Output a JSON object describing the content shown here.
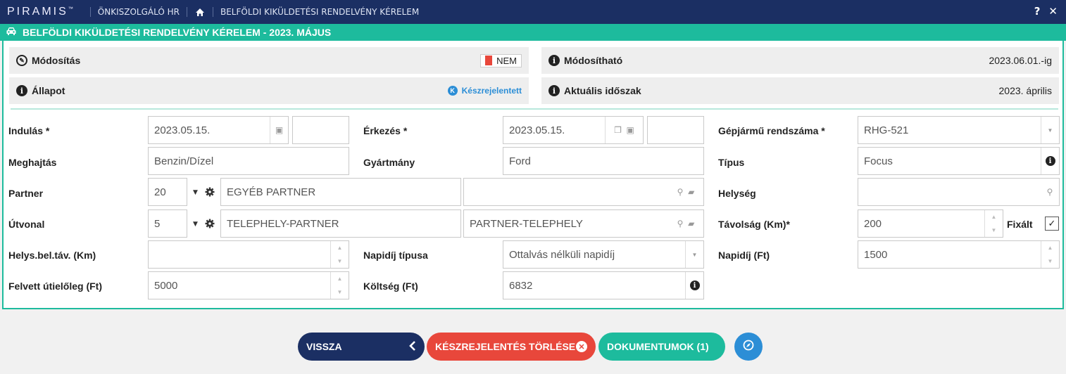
{
  "app": {
    "logo": "PIRAMIS",
    "tm": "™",
    "module": "ÖNKISZOLGÁLÓ HR",
    "page": "BELFÖLDI KIKÜLDETÉSI RENDELVÉNY KÉRELEM",
    "help": "?",
    "close": "✕"
  },
  "title": "BELFÖLDI KIKÜLDETÉSI RENDELVÉNY KÉRELEM - 2023. MÁJUS",
  "info": {
    "modositas": {
      "label": "Módosítás",
      "value": "NEM"
    },
    "modosithato": {
      "label": "Módosítható",
      "value": "2023.06.01.-ig"
    },
    "allapot": {
      "label": "Állapot",
      "value": "Készrejelentett",
      "badge": "K"
    },
    "aktualis": {
      "label": "Aktuális időszak",
      "value": "2023. április"
    }
  },
  "form": {
    "indulas": {
      "label": "Indulás *",
      "date": "2023.05.15.",
      "time": ""
    },
    "erkezes": {
      "label": "Érkezés *",
      "date": "2023.05.15.",
      "time": ""
    },
    "rendszam": {
      "label": "Gépjármű rendszáma *",
      "value": "RHG-521"
    },
    "meghajtas": {
      "label": "Meghajtás",
      "value": "Benzin/Dízel"
    },
    "gyartmany": {
      "label": "Gyártmány",
      "value": "Ford"
    },
    "tipus": {
      "label": "Típus",
      "value": "Focus"
    },
    "partner": {
      "label": "Partner",
      "code": "20",
      "name": "EGYÉB PARTNER",
      "extra": ""
    },
    "helyseg": {
      "label": "Helység",
      "value": ""
    },
    "utvonal": {
      "label": "Útvonal",
      "code": "5",
      "from": "TELEPHELY-PARTNER",
      "to": "PARTNER-TELEPHELY"
    },
    "tavolsag": {
      "label": "Távolság (Km)*",
      "value": "200",
      "fixalt_label": "Fixált",
      "fixalt_checked": true
    },
    "helysbeltav": {
      "label": "Helys.bel.táv. (Km)",
      "value": ""
    },
    "napidij_tipus": {
      "label": "Napidíj típusa",
      "value": "Ottalvás nélküli napidíj"
    },
    "napidij": {
      "label": "Napidíj (Ft)",
      "value": "1500"
    },
    "utieloleg": {
      "label": "Felvett útielőleg (Ft)",
      "value": "5000"
    },
    "koltseg": {
      "label": "Költség (Ft)",
      "value": "6832"
    }
  },
  "buttons": {
    "back": "VISSZA",
    "delete": "KÉSZREJELENTÉS TÖRLÉSE",
    "documents": "DOKUMENTUMOK (1)"
  },
  "colors": {
    "navy": "#1b2f63",
    "teal": "#1dbb9d",
    "red": "#e8473b",
    "blue": "#2c8ed6"
  }
}
